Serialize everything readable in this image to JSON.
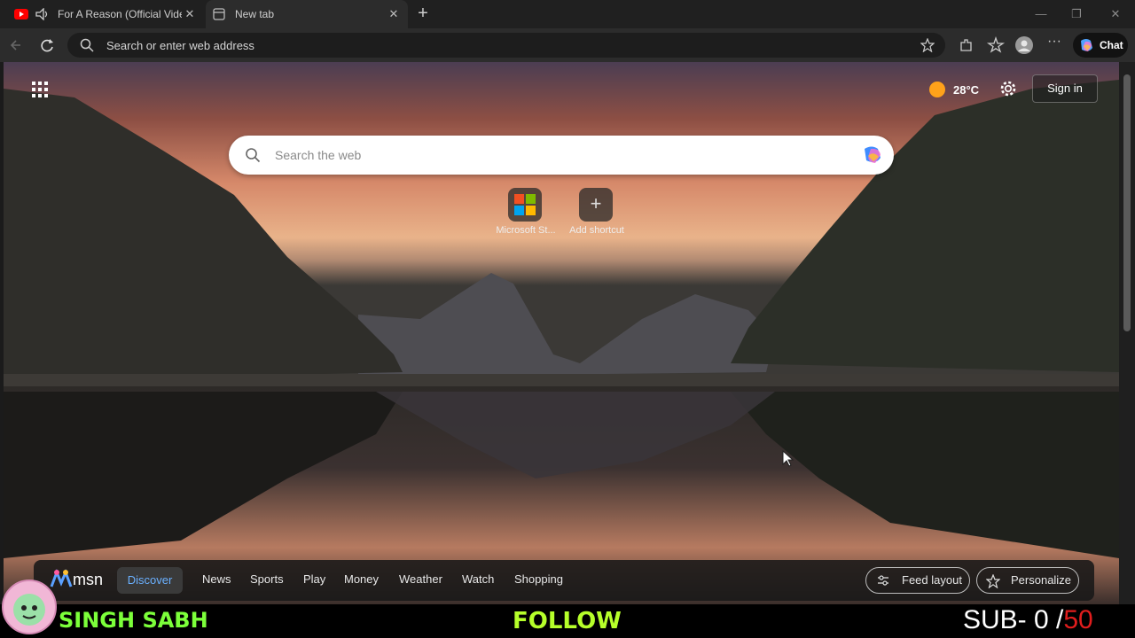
{
  "tabs": [
    {
      "title": "For A Reason (Official Vide",
      "icon": "youtube-icon",
      "audio": true
    },
    {
      "title": "New tab",
      "icon": "new-tab-icon"
    }
  ],
  "addressbar": {
    "placeholder": "Search or enter web address"
  },
  "toolbar": {
    "chat_label": "Chat"
  },
  "newtab": {
    "search_placeholder": "Search the web",
    "weather_temp": "28°C",
    "sign_in_label": "Sign in",
    "shortcuts": [
      {
        "label": "Microsoft St...",
        "icon": "microsoft-store-icon"
      },
      {
        "label": "Add shortcut",
        "icon": "plus-icon"
      }
    ]
  },
  "msn": {
    "logo_text": "msn",
    "nav": [
      "Discover",
      "News",
      "Sports",
      "Play",
      "Money",
      "Weather",
      "Watch",
      "Shopping"
    ],
    "active": "Discover",
    "feed_layout_label": "Feed layout",
    "personalize_label": "Personalize"
  },
  "overlay": {
    "streamer_name": "SINGH SABH",
    "follow_text": "FOLLOW",
    "sub_prefix": "SUB- 0 /",
    "sub_goal": "50"
  },
  "colors": {
    "accent": "#6ab0ff",
    "streamer": "#7cff3a",
    "follow": "#b6ff2a",
    "sub_goal": "#e11d1d"
  }
}
